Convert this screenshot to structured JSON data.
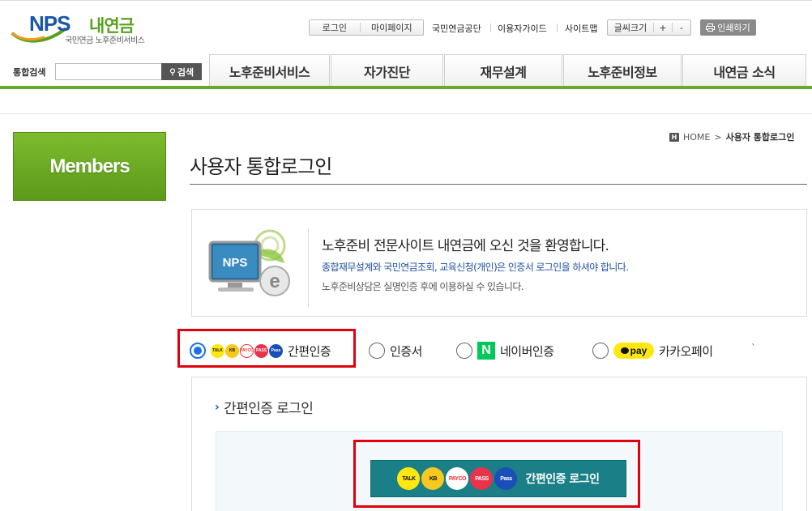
{
  "logo": {
    "brand": "NPS",
    "name": "내연금",
    "subtitle": "국민연금 노후준비서비스"
  },
  "utility": {
    "login": "로그인",
    "mypage": "마이페이지",
    "nps": "국민연금공단",
    "guide": "이용자가이드",
    "sitemap": "사이트맵",
    "font_size": "글씨크기",
    "font_plus": "+",
    "font_minus": "-",
    "print": "인쇄하기"
  },
  "search": {
    "label": "통합검색",
    "value": "",
    "button": "검색"
  },
  "nav": {
    "tabs": [
      {
        "label": "노후준비서비스"
      },
      {
        "label": "자가진단"
      },
      {
        "label": "재무설계"
      },
      {
        "label": "노후준비정보"
      },
      {
        "label": "내연금 소식"
      }
    ]
  },
  "sidebar": {
    "title": "Members"
  },
  "breadcrumb": {
    "home": "HOME",
    "sep": ">",
    "current": "사용자 통합로그인"
  },
  "page": {
    "title": "사용자 통합로그인"
  },
  "welcome": {
    "illustration_label": "NPS",
    "heading": "노후준비 전문사이트 내연금에 오신 것을 환영합니다.",
    "line1": "종합재무설계와 국민연금조회, 교육신청(개인)은 인증서 로그인을 하셔야 합니다.",
    "line2": "노후준비상담은 실명인증 후에 이용하실 수 있습니다."
  },
  "auth_options": [
    {
      "label": "간편인증",
      "selected": true
    },
    {
      "label": "인증서",
      "selected": false
    },
    {
      "label": "네이버인증",
      "selected": false,
      "icon_text": "N"
    },
    {
      "label": "카카오페이",
      "selected": false,
      "icon_text": "pay"
    }
  ],
  "auth_icons": {
    "kakao": "TALK",
    "kb": "KB",
    "payco": "PAYCO",
    "pass": "PASS",
    "samsung": "Pass"
  },
  "tick_mark": "`",
  "login_panel": {
    "title": "간편인증 로그인",
    "button": "간편인증 로그인"
  },
  "colors": {
    "brand_green": "#6aaa2a",
    "brand_blue": "#1a56a8",
    "button_teal": "#1a7f86",
    "highlight_red": "#e0000d"
  }
}
